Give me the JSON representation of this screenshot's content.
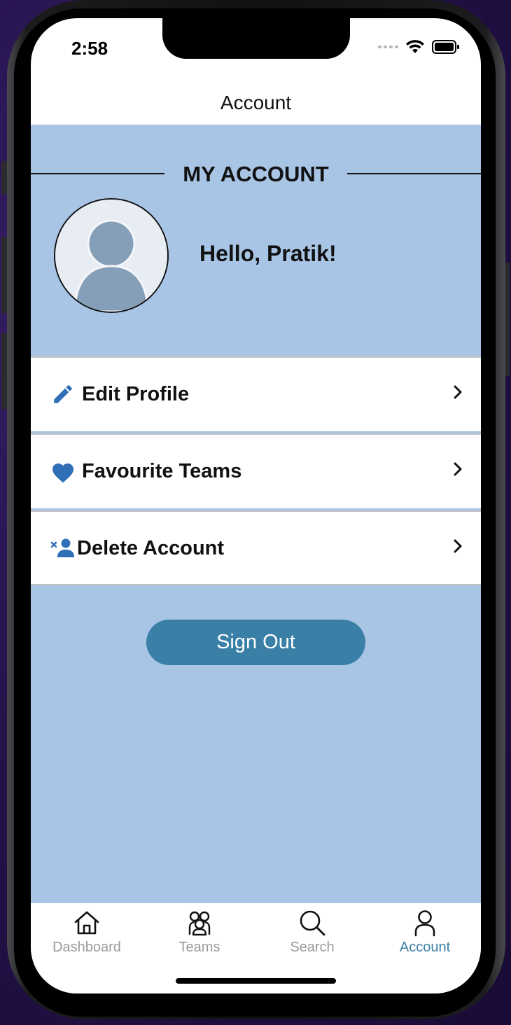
{
  "status_bar": {
    "time": "2:58"
  },
  "header": {
    "title": "Account"
  },
  "account": {
    "section_title": "MY ACCOUNT",
    "greeting": "Hello, Pratik!"
  },
  "menu": {
    "items": [
      {
        "label": "Edit Profile",
        "icon": "pencil-icon"
      },
      {
        "label": "Favourite Teams",
        "icon": "heart-icon"
      },
      {
        "label": "Delete Account",
        "icon": "remove-user-icon"
      }
    ]
  },
  "sign_out": {
    "label": "Sign Out"
  },
  "tabbar": {
    "tabs": [
      {
        "label": "Dashboard",
        "icon": "home-icon"
      },
      {
        "label": "Teams",
        "icon": "teams-icon"
      },
      {
        "label": "Search",
        "icon": "search-icon"
      },
      {
        "label": "Account",
        "icon": "person-icon",
        "active": true
      }
    ]
  },
  "colors": {
    "background": "#a8c5e6",
    "accent": "#3a7fa6",
    "icon_blue": "#2f6fb6",
    "avatar_fill": "#869fb8"
  }
}
